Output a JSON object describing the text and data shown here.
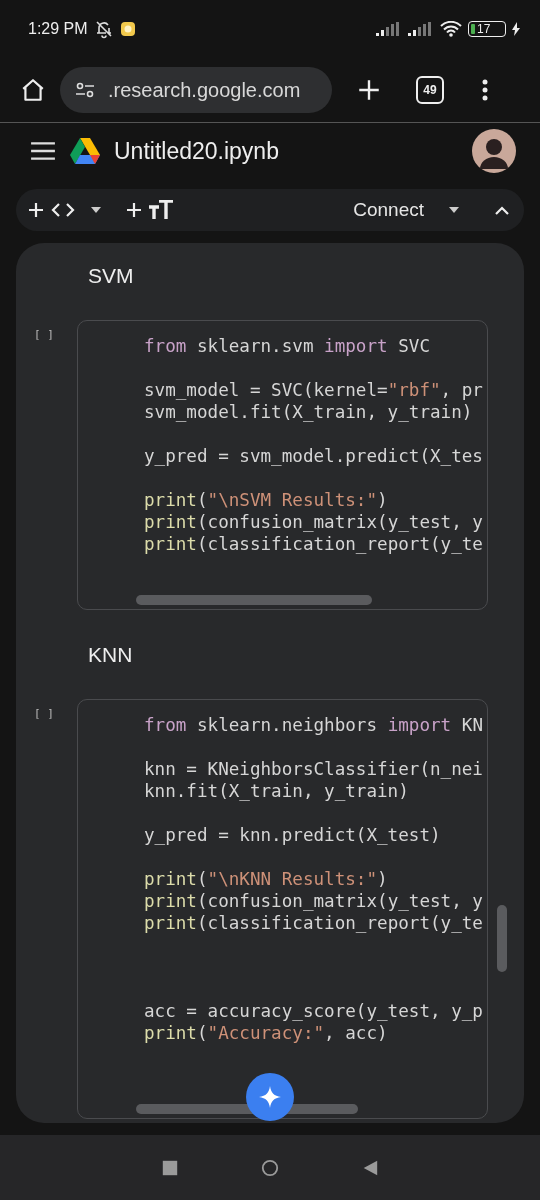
{
  "status_bar": {
    "time": "1:29 PM",
    "battery": "17"
  },
  "browser": {
    "url": ".research.google.com",
    "tab_count": "49"
  },
  "header": {
    "title": "Untitled20.ipynb"
  },
  "toolbar": {
    "connect": "Connect"
  },
  "cells": [
    {
      "kind": "text",
      "text": "SVM"
    },
    {
      "kind": "code",
      "run_label": "[ ]",
      "lines": [
        {
          "kind": "code",
          "tokens": [
            {
              "kind": "keyword",
              "text": "from"
            },
            {
              "kind": "plain",
              "text": " sklearn.svm "
            },
            {
              "kind": "keyword",
              "text": "import"
            },
            {
              "kind": "plain",
              "text": " SVC"
            }
          ]
        },
        {
          "kind": "blank"
        },
        {
          "kind": "code",
          "tokens": [
            {
              "kind": "plain",
              "text": "svm_model = SVC(kernel="
            },
            {
              "kind": "string",
              "text": "\"rbf\""
            },
            {
              "kind": "plain",
              "text": ", pr"
            }
          ]
        },
        {
          "kind": "code",
          "tokens": [
            {
              "kind": "plain",
              "text": "svm_model.fit(X_train, y_train)"
            }
          ]
        },
        {
          "kind": "blank"
        },
        {
          "kind": "code",
          "tokens": [
            {
              "kind": "plain",
              "text": "y_pred = svm_model.predict(X_tes"
            }
          ]
        },
        {
          "kind": "blank"
        },
        {
          "kind": "code",
          "tokens": [
            {
              "kind": "func",
              "text": "print"
            },
            {
              "kind": "plain",
              "text": "("
            },
            {
              "kind": "string",
              "text": "\"\\nSVM Results:\""
            },
            {
              "kind": "plain",
              "text": ")"
            }
          ]
        },
        {
          "kind": "code",
          "tokens": [
            {
              "kind": "func",
              "text": "print"
            },
            {
              "kind": "plain",
              "text": "(confusion_matrix(y_test, y"
            }
          ]
        },
        {
          "kind": "code",
          "tokens": [
            {
              "kind": "func",
              "text": "print"
            },
            {
              "kind": "plain",
              "text": "(classification_report(y_te"
            }
          ]
        }
      ]
    },
    {
      "kind": "text",
      "text": "KNN"
    },
    {
      "kind": "code",
      "run_label": "[ ]",
      "lines": [
        {
          "kind": "code",
          "tokens": [
            {
              "kind": "keyword",
              "text": "from"
            },
            {
              "kind": "plain",
              "text": " sklearn.neighbors "
            },
            {
              "kind": "keyword",
              "text": "import"
            },
            {
              "kind": "plain",
              "text": " KN"
            }
          ]
        },
        {
          "kind": "blank"
        },
        {
          "kind": "code",
          "tokens": [
            {
              "kind": "plain",
              "text": "knn = KNeighborsClassifier(n_nei"
            }
          ]
        },
        {
          "kind": "code",
          "tokens": [
            {
              "kind": "plain",
              "text": "knn.fit(X_train, y_train)"
            }
          ]
        },
        {
          "kind": "blank"
        },
        {
          "kind": "code",
          "tokens": [
            {
              "kind": "plain",
              "text": "y_pred = knn.predict(X_test)"
            }
          ]
        },
        {
          "kind": "blank"
        },
        {
          "kind": "code",
          "tokens": [
            {
              "kind": "func",
              "text": "print"
            },
            {
              "kind": "plain",
              "text": "("
            },
            {
              "kind": "string",
              "text": "\"\\nKNN Results:\""
            },
            {
              "kind": "plain",
              "text": ")"
            }
          ]
        },
        {
          "kind": "code",
          "tokens": [
            {
              "kind": "func",
              "text": "print"
            },
            {
              "kind": "plain",
              "text": "(confusion_matrix(y_test, y"
            }
          ]
        },
        {
          "kind": "code",
          "tokens": [
            {
              "kind": "func",
              "text": "print"
            },
            {
              "kind": "plain",
              "text": "(classification_report(y_te"
            }
          ]
        },
        {
          "kind": "blank"
        },
        {
          "kind": "blank"
        },
        {
          "kind": "blank"
        },
        {
          "kind": "code",
          "tokens": [
            {
              "kind": "plain",
              "text": "acc = accuracy_score(y_test, y_p"
            }
          ]
        },
        {
          "kind": "code",
          "tokens": [
            {
              "kind": "func",
              "text": "print"
            },
            {
              "kind": "plain",
              "text": "("
            },
            {
              "kind": "string",
              "text": "\"Accuracy:\""
            },
            {
              "kind": "plain",
              "text": ", acc)"
            }
          ]
        }
      ]
    }
  ]
}
